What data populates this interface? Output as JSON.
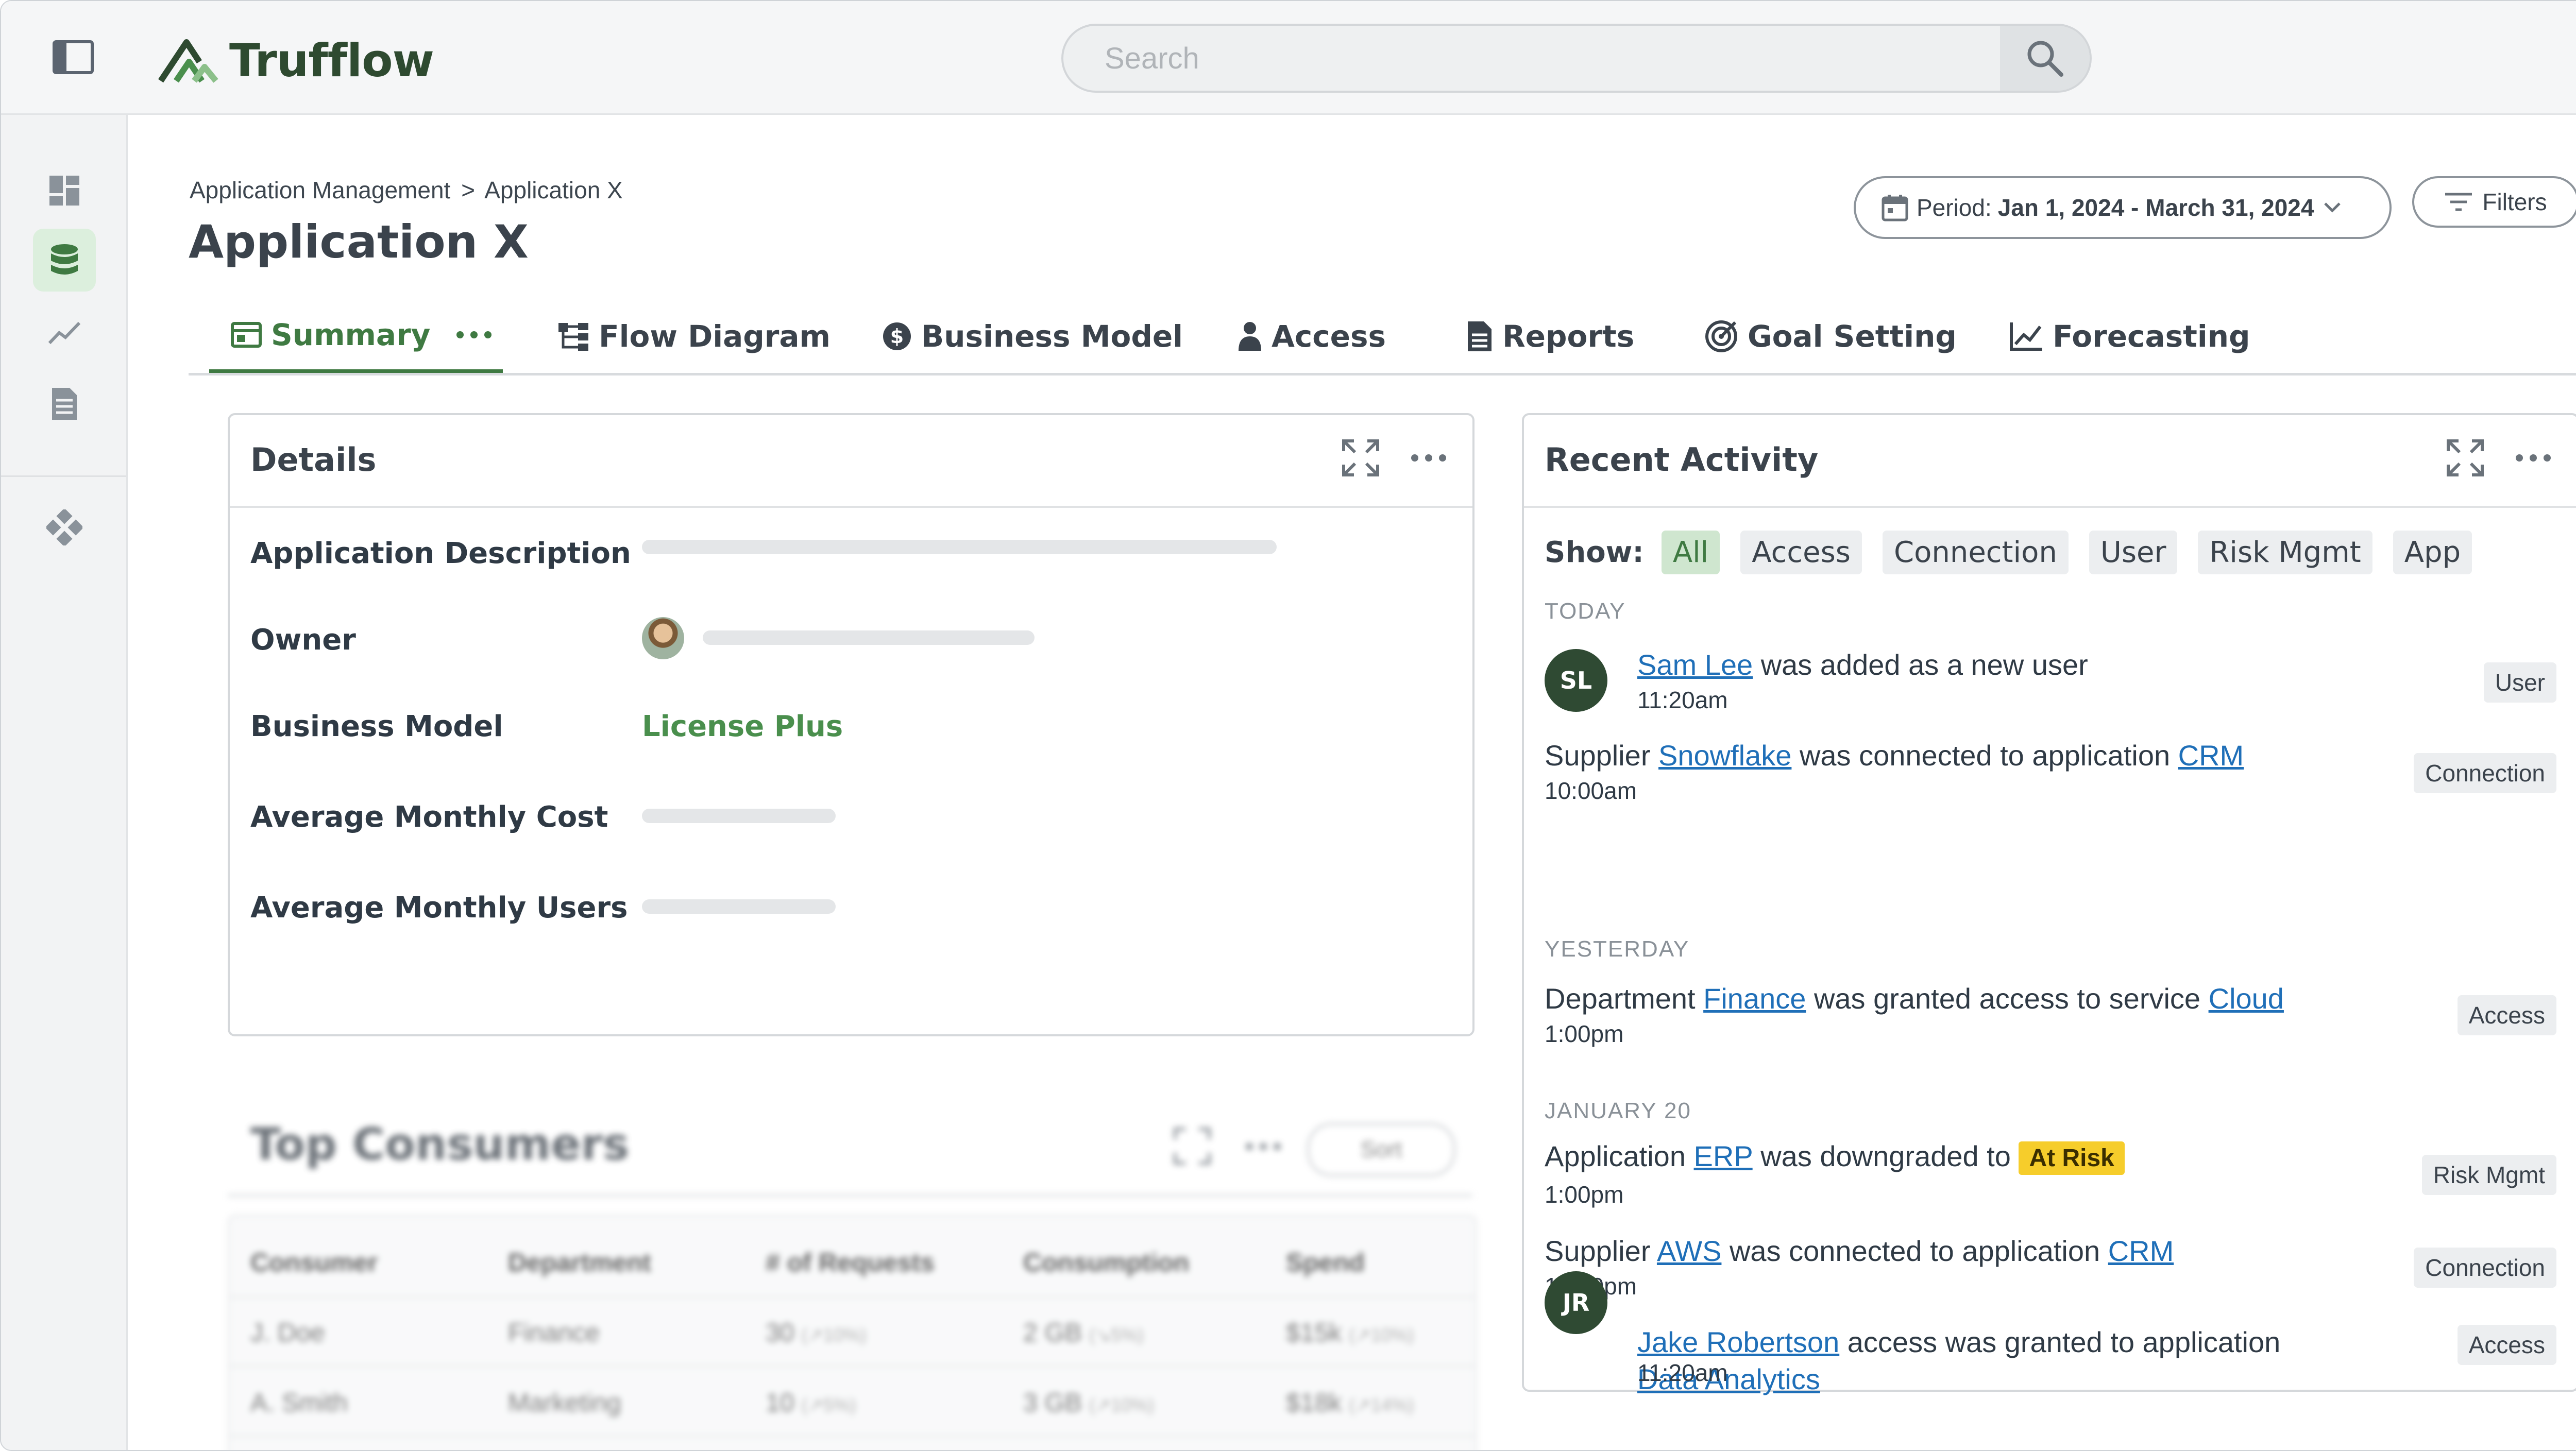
{
  "app": {
    "name": "Trufflow"
  },
  "search": {
    "placeholder": "Search"
  },
  "breadcrumb": {
    "parent": "Application Management",
    "separator": ">",
    "current": "Application X"
  },
  "page": {
    "title": "Application X"
  },
  "period": {
    "label": "Period:",
    "value": "Jan 1, 2024 - March 31, 2024"
  },
  "filters": {
    "label": "Filters"
  },
  "tabs": [
    {
      "label": "Summary",
      "icon": "summary-icon"
    },
    {
      "label": "Flow Diagram",
      "icon": "flow-icon"
    },
    {
      "label": "Business Model",
      "icon": "dollar-icon"
    },
    {
      "label": "Access",
      "icon": "user-icon"
    },
    {
      "label": "Reports",
      "icon": "document-icon"
    },
    {
      "label": "Goal Setting",
      "icon": "target-icon"
    },
    {
      "label": "Forecasting",
      "icon": "chart-icon"
    }
  ],
  "details": {
    "title": "Details",
    "rows": [
      {
        "label": "Application Description"
      },
      {
        "label": "Owner"
      },
      {
        "label": "Business Model",
        "value": "License Plus"
      },
      {
        "label": "Average Monthly Cost"
      },
      {
        "label": "Average Monthly Users"
      }
    ]
  },
  "activity": {
    "title": "Recent Activity",
    "show_label": "Show:",
    "filters": [
      "All",
      "Access",
      "Connection",
      "User",
      "Risk Mgmt",
      "App"
    ],
    "sections": {
      "today": "TODAY",
      "yesterday": "YESTERDAY",
      "jan20": "JANUARY 20"
    },
    "items": [
      {
        "a": "Sam Lee",
        "b": "was added as a new user",
        "time": "11:20am",
        "tag": "User",
        "initials": "SL"
      },
      {
        "pre": "Supplier",
        "a": "Snowflake",
        "b": "was connected to application",
        "c": "CRM",
        "time": "10:00am",
        "tag": "Connection"
      },
      {
        "pre": "Department",
        "a": "Finance",
        "b": "was granted access to service",
        "c": "Cloud",
        "time": "1:00pm",
        "tag": "Access"
      },
      {
        "pre": "Application",
        "a": "ERP",
        "b": "was downgraded to",
        "badge": "At Risk",
        "time": "1:00pm",
        "tag": "Risk Mgmt"
      },
      {
        "pre": "Supplier",
        "a": "AWS",
        "b": "was connected to application",
        "c": "CRM",
        "time": "12:00pm",
        "tag": "Connection"
      },
      {
        "a": "Jake Robertson",
        "b": "access was granted to application",
        "c": "Data Analytics",
        "time": "11:20am",
        "tag": "Access",
        "initials": "JR"
      }
    ]
  },
  "top_consumers": {
    "title": "Top Consumers",
    "sort_label": "Sort",
    "columns": [
      "Consumer",
      "Department",
      "# of Requests",
      "Consumption",
      "Spend"
    ],
    "rows": [
      [
        "J. Doe",
        "Finance",
        "30",
        "(↗10%)",
        "2 GB",
        "(↘5%)",
        "$15k",
        "(↗10%)"
      ],
      [
        "A. Smith",
        "Marketing",
        "10",
        "(↗5%)",
        "3 GB",
        "(↗10%)",
        "$18k",
        "(↗14%)"
      ]
    ]
  },
  "colors": {
    "brand": "#2e4a30",
    "accent": "#3f7a42",
    "link": "#1f6fb8",
    "risk": "#f6cd2b"
  }
}
